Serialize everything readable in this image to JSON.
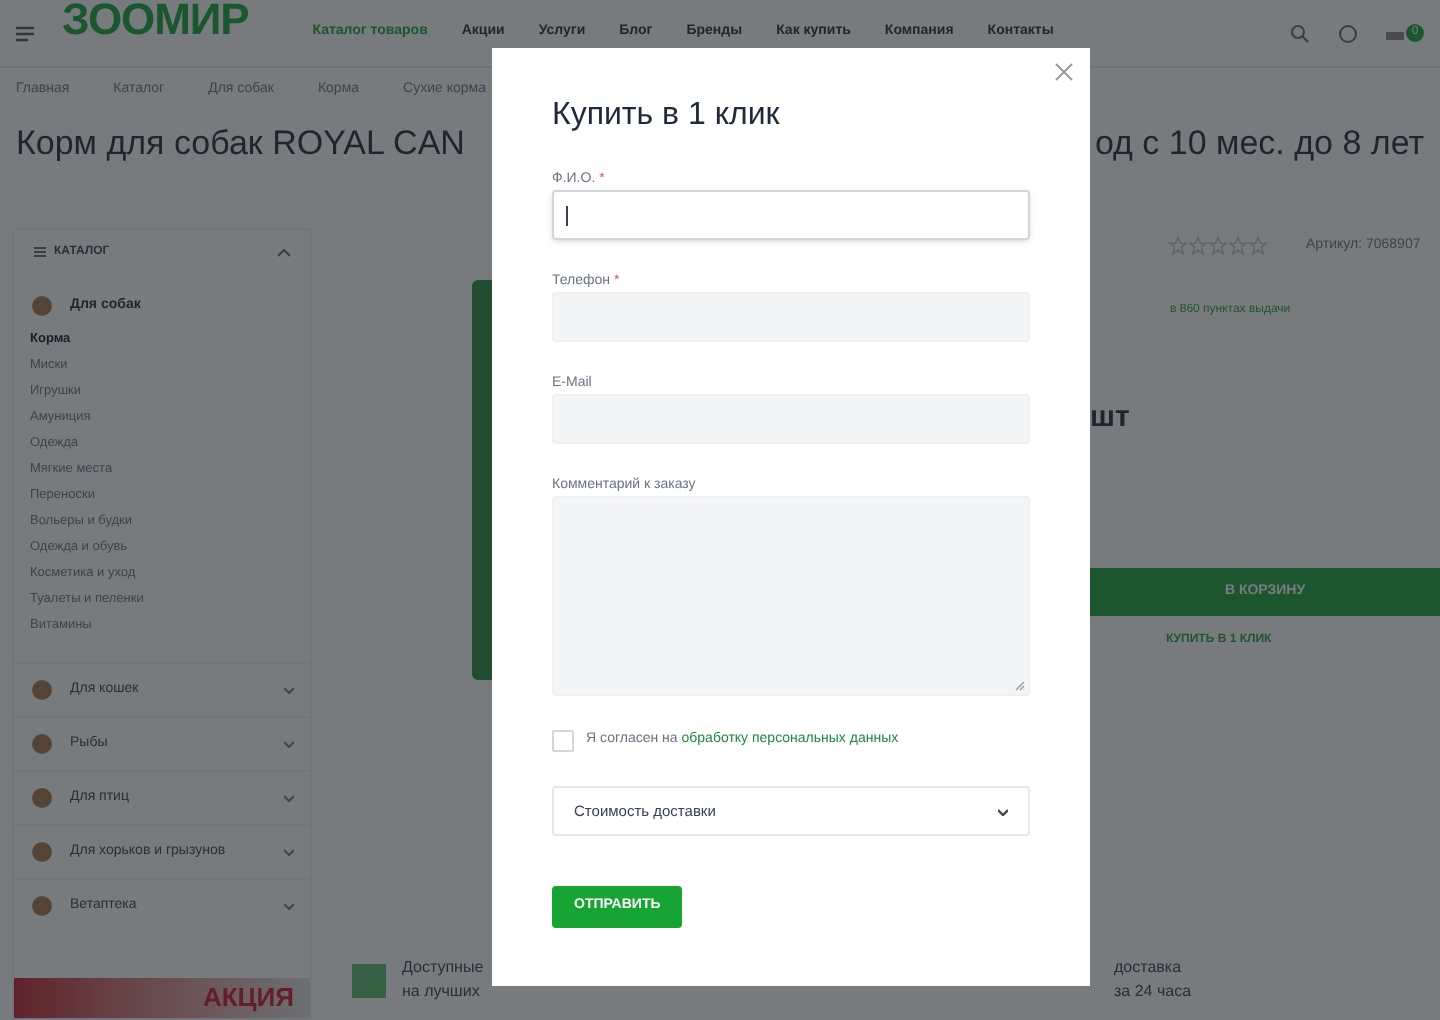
{
  "header": {
    "logo": "ЗООМИР",
    "nav": [
      {
        "label": "Каталог товаров",
        "selected": true
      },
      {
        "label": "Акции",
        "selected": false
      },
      {
        "label": "Услуги",
        "selected": false
      },
      {
        "label": "Блог",
        "selected": false
      },
      {
        "label": "Бренды",
        "selected": false
      },
      {
        "label": "Как купить",
        "selected": false
      },
      {
        "label": "Компания",
        "selected": false
      },
      {
        "label": "Контакты",
        "selected": false
      }
    ],
    "cart_count": "0"
  },
  "breadcrumbs": [
    "Главная",
    "Каталог",
    "Для собак",
    "Корма",
    "Сухие корма"
  ],
  "title_parts": [
    "Корм для собак ROYAL CAN",
    "од с 10 мес. до 8 лет"
  ],
  "sidebar": {
    "title": "КАТАЛОГ",
    "items": [
      {
        "label": "Для собак",
        "expanded": true,
        "children": [
          {
            "label": "Корма",
            "selected": true
          },
          {
            "label": "Миски",
            "selected": false
          },
          {
            "label": "Игрушки",
            "selected": false
          },
          {
            "label": "Амуниция",
            "selected": false
          },
          {
            "label": "Одежда",
            "selected": false
          },
          {
            "label": "Мягкие места",
            "selected": false
          },
          {
            "label": "Переноски",
            "selected": false
          },
          {
            "label": "Вольеры и будки",
            "selected": false
          },
          {
            "label": "Одежда и обувь",
            "selected": false
          },
          {
            "label": "Косметика и уход",
            "selected": false
          },
          {
            "label": "Туалеты и пеленки",
            "selected": false
          },
          {
            "label": "Витамины",
            "selected": false
          }
        ]
      },
      {
        "label": "Для кошек",
        "expanded": false
      },
      {
        "label": "Рыбы",
        "expanded": false
      },
      {
        "label": "Для птиц",
        "expanded": false
      },
      {
        "label": "Для хорьков и грызунов",
        "expanded": false
      },
      {
        "label": "Ветаптека",
        "expanded": false
      }
    ]
  },
  "promo_banner": "АКЦИЯ",
  "product": {
    "stars": 0,
    "sku": "Артикул: 7068907",
    "pickup_note": "в 860 пунктах выдачи",
    "unit": "шт",
    "add_to_cart": "В КОРЗИНУ",
    "buy_one_click": "КУПИТЬ В 1 КЛИК"
  },
  "features": [
    {
      "lines": [
        "Доступные",
        "на лучших"
      ]
    },
    {
      "lines": [
        "доставка",
        "за 24 часа"
      ]
    }
  ],
  "modal": {
    "title": "Купить в 1 клик",
    "fields": [
      {
        "kind": "input",
        "label": "Ф.И.О.",
        "required_mark": "*",
        "focused": true
      },
      {
        "kind": "input",
        "label": "Телефон",
        "required_mark": "*",
        "focused": false
      },
      {
        "kind": "input",
        "label": "E-Mail",
        "focused": false
      },
      {
        "kind": "textarea",
        "label": "Комментарий к заказу",
        "focused": false
      }
    ],
    "consent": {
      "checked": false,
      "text": "Я согласен на",
      "link": "обработку персональных данных"
    },
    "select": {
      "value": "Стоимость доставки"
    },
    "submit": "ОТПРАВИТЬ"
  }
}
